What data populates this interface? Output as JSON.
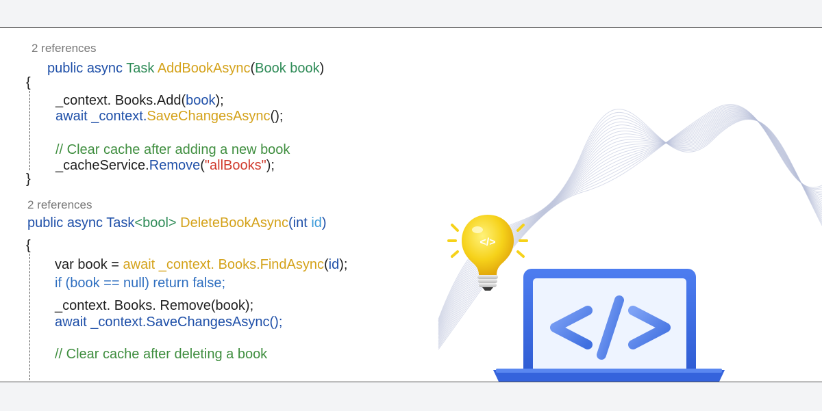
{
  "method1": {
    "references": "2 references",
    "signature": {
      "kw": "public async ",
      "type": "Task ",
      "name": "AddBookAsync",
      "open": "(",
      "ptype": "Book book",
      "close": ")"
    },
    "open_brace": "{",
    "line1": {
      "a": "_context. Books.Add(",
      "b": "book",
      "c": ");"
    },
    "line2": {
      "a": "await _context.",
      "b": "SaveChangesAsync",
      "c": "();"
    },
    "comment": "// Clear cache after adding a new book",
    "line3": {
      "a": "_cacheService.",
      "b": "Remove",
      "c": "(",
      "d": "\"allBooks\"",
      "e": ");"
    },
    "close_brace": "}"
  },
  "method2": {
    "references": "2 references",
    "signature": {
      "kw": "public async Task",
      "gen": "<bool> ",
      "name": "DeleteBookAsync",
      "open": "(int ",
      "param": "id",
      "close": ")"
    },
    "open_brace": "{",
    "line1": {
      "a": "var book = ",
      "b": "await _context. Books.FindAsync",
      "c": "(",
      "d": "id",
      "e": ");"
    },
    "line2": "if (book == null) return false;",
    "line3": "_context. Books. Remove(book);",
    "line4": "await _context.SaveChangesAsync();",
    "comment": "// Clear cache after deleting a book"
  },
  "illustration": {
    "bulb_icon": "lightbulb-code-icon",
    "laptop_icon": "laptop-code-icon",
    "bulb_symbol": "</>",
    "colors": {
      "laptop": "#3f6fe0",
      "screen": "#eef4ff",
      "code": "#5b86ee",
      "bulb": "#f6d21a",
      "wave": "#b8c0d8"
    }
  }
}
